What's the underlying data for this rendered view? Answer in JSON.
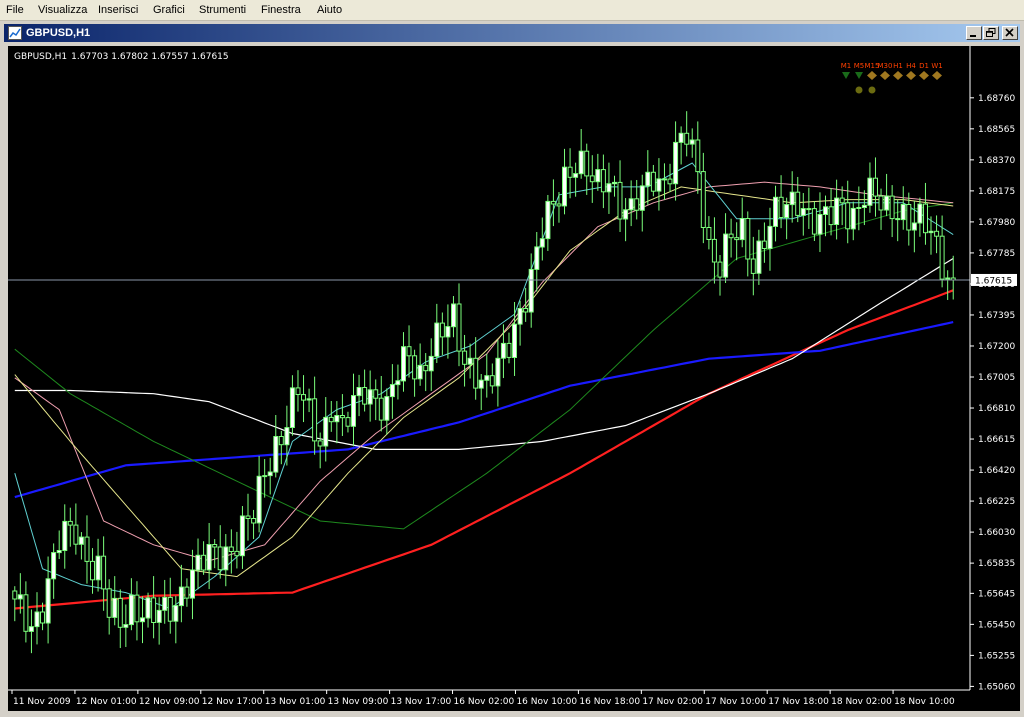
{
  "menu": {
    "items": [
      "File",
      "Visualizza",
      "Inserisci",
      "Grafici",
      "Strumenti",
      "Finestra",
      "Aiuto"
    ]
  },
  "window": {
    "title": "GBPUSD,H1",
    "icon": "chart-window-icon",
    "buttons": [
      "minimize-icon",
      "restore-icon",
      "close-icon"
    ],
    "title_gradient": [
      "#0a246a",
      "#a6caf0"
    ]
  },
  "chart_data": {
    "type": "candlestick",
    "symbol_label": "GBPUSD,H1",
    "ohlc_label": "1.67703 1.67802 1.67557 1.67615",
    "current_price": 1.67615,
    "current_price_label": "1.67615",
    "ylim": [
      1.6505,
      1.6896
    ],
    "y_ticks": [
      "1.68760",
      "1.68565",
      "1.68370",
      "1.68175",
      "1.67980",
      "1.67785",
      "1.67590",
      "1.67395",
      "1.67200",
      "1.67005",
      "1.66810",
      "1.66615",
      "1.66420",
      "1.66225",
      "1.66030",
      "1.65835",
      "1.65645",
      "1.65450",
      "1.65255",
      "1.65060"
    ],
    "x_ticks": [
      "11 Nov 2009",
      "12 Nov 01:00",
      "12 Nov 09:00",
      "12 Nov 17:00",
      "13 Nov 01:00",
      "13 Nov 09:00",
      "13 Nov 17:00",
      "16 Nov 02:00",
      "16 Nov 10:00",
      "16 Nov 18:00",
      "17 Nov 02:00",
      "17 Nov 10:00",
      "17 Nov 18:00",
      "18 Nov 02:00",
      "18 Nov 10:00"
    ],
    "anchors": [
      [
        0,
        1.6555
      ],
      [
        3,
        1.6545
      ],
      [
        5,
        1.656
      ],
      [
        8,
        1.6595
      ],
      [
        11,
        1.6605
      ],
      [
        13,
        1.659
      ],
      [
        15,
        1.658
      ],
      [
        17,
        1.655
      ],
      [
        19,
        1.6545
      ],
      [
        21,
        1.656
      ],
      [
        23,
        1.6555
      ],
      [
        25,
        1.6548
      ],
      [
        27,
        1.655
      ],
      [
        29,
        1.656
      ],
      [
        31,
        1.6575
      ],
      [
        33,
        1.658
      ],
      [
        35,
        1.6585
      ],
      [
        37,
        1.659
      ],
      [
        39,
        1.6595
      ],
      [
        41,
        1.6605
      ],
      [
        43,
        1.661
      ],
      [
        45,
        1.664
      ],
      [
        47,
        1.666
      ],
      [
        49,
        1.6675
      ],
      [
        51,
        1.669
      ],
      [
        53,
        1.6675
      ],
      [
        55,
        1.6662
      ],
      [
        57,
        1.6685
      ],
      [
        59,
        1.6665
      ],
      [
        61,
        1.668
      ],
      [
        63,
        1.6695
      ],
      [
        65,
        1.669
      ],
      [
        67,
        1.668
      ],
      [
        69,
        1.67
      ],
      [
        71,
        1.6715
      ],
      [
        73,
        1.6705
      ],
      [
        75,
        1.672
      ],
      [
        77,
        1.6725
      ],
      [
        79,
        1.6735
      ],
      [
        81,
        1.6715
      ],
      [
        83,
        1.6705
      ],
      [
        85,
        1.669
      ],
      [
        87,
        1.6705
      ],
      [
        89,
        1.6725
      ],
      [
        91,
        1.6745
      ],
      [
        93,
        1.676
      ],
      [
        95,
        1.679
      ],
      [
        97,
        1.681
      ],
      [
        99,
        1.683
      ],
      [
        101,
        1.6835
      ],
      [
        103,
        1.6825
      ],
      [
        105,
        1.682
      ],
      [
        107,
        1.683
      ],
      [
        109,
        1.681
      ],
      [
        111,
        1.68
      ],
      [
        113,
        1.6815
      ],
      [
        115,
        1.683
      ],
      [
        117,
        1.6825
      ],
      [
        119,
        1.684
      ],
      [
        121,
        1.685
      ],
      [
        123,
        1.683
      ],
      [
        125,
        1.6785
      ],
      [
        127,
        1.677
      ],
      [
        129,
        1.6785
      ],
      [
        131,
        1.679
      ],
      [
        133,
        1.6775
      ],
      [
        135,
        1.679
      ],
      [
        137,
        1.68
      ],
      [
        139,
        1.6805
      ],
      [
        141,
        1.6815
      ],
      [
        143,
        1.6805
      ],
      [
        145,
        1.6795
      ],
      [
        147,
        1.68
      ],
      [
        149,
        1.681
      ],
      [
        151,
        1.6805
      ],
      [
        153,
        1.6815
      ],
      [
        155,
        1.681
      ],
      [
        157,
        1.6805
      ],
      [
        159,
        1.681
      ],
      [
        161,
        1.68
      ],
      [
        163,
        1.6795
      ],
      [
        165,
        1.679
      ],
      [
        167,
        1.6775
      ],
      [
        169,
        1.676
      ]
    ],
    "moving_averages": [
      {
        "color": "#ff2020",
        "width": 2.2,
        "points": [
          [
            0,
            1.6555
          ],
          [
            25,
            1.6563
          ],
          [
            50,
            1.6565
          ],
          [
            75,
            1.6595
          ],
          [
            100,
            1.664
          ],
          [
            125,
            1.669
          ],
          [
            150,
            1.673
          ],
          [
            169,
            1.6755
          ]
        ]
      },
      {
        "color": "#1a1aff",
        "width": 2.2,
        "points": [
          [
            0,
            1.6625
          ],
          [
            20,
            1.6645
          ],
          [
            40,
            1.665
          ],
          [
            60,
            1.6655
          ],
          [
            80,
            1.6672
          ],
          [
            100,
            1.6695
          ],
          [
            125,
            1.6712
          ],
          [
            145,
            1.6717
          ],
          [
            169,
            1.6735
          ]
        ]
      },
      {
        "color": "#ffffff",
        "width": 1.2,
        "points": [
          [
            0,
            1.6692
          ],
          [
            10,
            1.6692
          ],
          [
            25,
            1.669
          ],
          [
            35,
            1.6685
          ],
          [
            50,
            1.6665
          ],
          [
            65,
            1.6655
          ],
          [
            80,
            1.6655
          ],
          [
            95,
            1.666
          ],
          [
            110,
            1.667
          ],
          [
            125,
            1.669
          ],
          [
            140,
            1.6712
          ],
          [
            155,
            1.6745
          ],
          [
            169,
            1.6775
          ]
        ]
      },
      {
        "color": "#1e8a1e",
        "width": 1,
        "points": [
          [
            0,
            1.6718
          ],
          [
            10,
            1.669
          ],
          [
            25,
            1.666
          ],
          [
            40,
            1.6635
          ],
          [
            55,
            1.661
          ],
          [
            70,
            1.6605
          ],
          [
            85,
            1.664
          ],
          [
            100,
            1.668
          ],
          [
            115,
            1.673
          ],
          [
            130,
            1.6775
          ],
          [
            145,
            1.679
          ],
          [
            160,
            1.6805
          ],
          [
            169,
            1.681
          ]
        ]
      },
      {
        "color": "#f0a0b0",
        "width": 1,
        "points": [
          [
            0,
            1.67
          ],
          [
            8,
            1.668
          ],
          [
            16,
            1.661
          ],
          [
            25,
            1.6595
          ],
          [
            35,
            1.6585
          ],
          [
            45,
            1.6595
          ],
          [
            55,
            1.6635
          ],
          [
            65,
            1.6665
          ],
          [
            75,
            1.669
          ],
          [
            85,
            1.6715
          ],
          [
            95,
            1.676
          ],
          [
            105,
            1.6795
          ],
          [
            115,
            1.681
          ],
          [
            125,
            1.682
          ],
          [
            135,
            1.6823
          ],
          [
            145,
            1.682
          ],
          [
            155,
            1.6815
          ],
          [
            169,
            1.681
          ]
        ]
      },
      {
        "color": "#e6e68c",
        "width": 1,
        "points": [
          [
            0,
            1.6702
          ],
          [
            10,
            1.666
          ],
          [
            20,
            1.662
          ],
          [
            30,
            1.658
          ],
          [
            40,
            1.6575
          ],
          [
            50,
            1.66
          ],
          [
            60,
            1.664
          ],
          [
            70,
            1.6675
          ],
          [
            80,
            1.67
          ],
          [
            90,
            1.6735
          ],
          [
            100,
            1.678
          ],
          [
            110,
            1.6805
          ],
          [
            120,
            1.682
          ],
          [
            130,
            1.6815
          ],
          [
            140,
            1.681
          ],
          [
            150,
            1.6812
          ],
          [
            160,
            1.6812
          ],
          [
            169,
            1.6808
          ]
        ]
      },
      {
        "color": "#5fd0d0",
        "width": 1,
        "points": [
          [
            0,
            1.664
          ],
          [
            5,
            1.658
          ],
          [
            12,
            1.657
          ],
          [
            20,
            1.6565
          ],
          [
            28,
            1.6555
          ],
          [
            36,
            1.6575
          ],
          [
            44,
            1.66
          ],
          [
            50,
            1.666
          ],
          [
            58,
            1.668
          ],
          [
            66,
            1.669
          ],
          [
            74,
            1.671
          ],
          [
            82,
            1.672
          ],
          [
            90,
            1.674
          ],
          [
            98,
            1.6815
          ],
          [
            106,
            1.682
          ],
          [
            114,
            1.682
          ],
          [
            122,
            1.6835
          ],
          [
            130,
            1.68
          ],
          [
            140,
            1.68
          ],
          [
            150,
            1.681
          ],
          [
            160,
            1.681
          ],
          [
            169,
            1.679
          ]
        ]
      }
    ],
    "grid": false,
    "colors": {
      "background": "#000000",
      "bull": "#ffffff",
      "bear": "#000000",
      "wick": "#7cff7c",
      "axis": "#ffffff"
    }
  },
  "signals": {
    "labels": [
      "M1",
      "M5",
      "M15",
      "M30",
      "H1",
      "H4",
      "D1",
      "W1"
    ],
    "label_color": "#ff4000",
    "arrow_colors": [
      "#1a6b1a",
      "#1a6b1a",
      "#a07820",
      "#a07820",
      "#a07820",
      "#a07820",
      "#a07820",
      "#a07820"
    ],
    "arrow_dirs": [
      "down",
      "down",
      "diamond",
      "diamond",
      "diamond",
      "diamond",
      "diamond",
      "diamond"
    ],
    "dot_color": "#6b6b10",
    "dot_count": 2
  }
}
